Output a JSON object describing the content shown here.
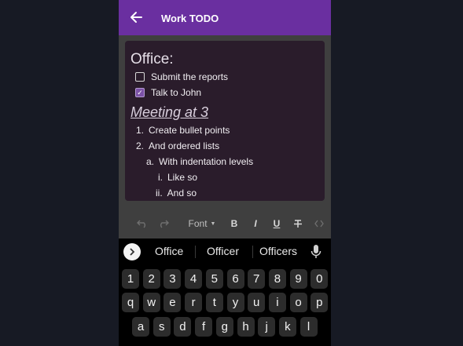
{
  "app_bar": {
    "title": "Work TODO",
    "back_icon": "arrow-left-icon"
  },
  "note": {
    "heading": "Office:",
    "checklist": [
      {
        "label": "Submit the reports",
        "checked": false
      },
      {
        "label": "Talk to John",
        "checked": true
      }
    ],
    "subheading": "Meeting at 3",
    "list": [
      {
        "marker": "1.",
        "text": "Create bullet points"
      },
      {
        "marker": "2.",
        "text": "And ordered lists"
      },
      {
        "marker": "a.",
        "text": "With indentation levels"
      },
      {
        "marker": "i.",
        "text": "Like so"
      },
      {
        "marker": "ii.",
        "text": "And so"
      }
    ]
  },
  "toolbar": {
    "undo": "undo-icon",
    "redo": "redo-icon",
    "font_label": "Font",
    "bold": "B",
    "italic": "I",
    "underline": "U",
    "strikethrough": "strikethrough-icon",
    "code": "code-icon"
  },
  "keyboard": {
    "suggestions": [
      "Office",
      "Officer",
      "Officers"
    ],
    "expand_icon": "chevron-right-icon",
    "mic_icon": "mic-icon",
    "row1": [
      "1",
      "2",
      "3",
      "4",
      "5",
      "6",
      "7",
      "8",
      "9",
      "0"
    ],
    "row2": [
      "q",
      "w",
      "e",
      "r",
      "t",
      "y",
      "u",
      "i",
      "o",
      "p"
    ],
    "row3": [
      "a",
      "s",
      "d",
      "f",
      "g",
      "h",
      "j",
      "k",
      "l"
    ]
  },
  "colors": {
    "app_bar": "#6a2fa0",
    "note_bg": "#2a1c2b",
    "checked_box": "#7b51a6",
    "page_bg": "#171a24"
  }
}
